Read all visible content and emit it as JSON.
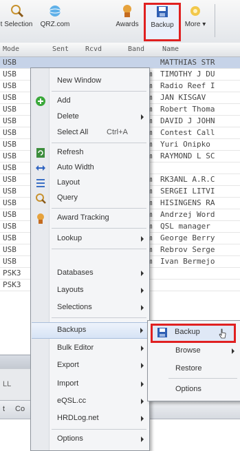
{
  "toolbar": {
    "items": [
      {
        "label": "t Selection"
      },
      {
        "label": "QRZ.com"
      },
      {
        "label": "Awards"
      },
      {
        "label": "Backup"
      },
      {
        "label": "More"
      }
    ]
  },
  "grid": {
    "columns": [
      "Mode",
      "Sent",
      "Rcvd",
      "Band",
      "Name"
    ],
    "rows": [
      {
        "mode": "USB",
        "band": "",
        "name": "MATTHIAS STR"
      },
      {
        "mode": "USB",
        "band": "m",
        "name": "TIMOTHY J DU"
      },
      {
        "mode": "USB",
        "band": "m",
        "name": "Radio Reef I"
      },
      {
        "mode": "USB",
        "band": "m",
        "name": "JAN KISGAV"
      },
      {
        "mode": "USB",
        "band": "m",
        "name": "Robert Thoma"
      },
      {
        "mode": "USB",
        "band": "m",
        "name": "DAVID J JOHN"
      },
      {
        "mode": "USB",
        "band": "m",
        "name": "Contest Call"
      },
      {
        "mode": "USB",
        "band": "m",
        "name": "Yuri Onipko"
      },
      {
        "mode": "USB",
        "band": "m",
        "name": "RAYMOND L SC"
      },
      {
        "mode": "USB",
        "band": "",
        "name": ""
      },
      {
        "mode": "USB",
        "band": "m",
        "name": "RK3ANL A.R.C"
      },
      {
        "mode": "USB",
        "band": "m",
        "name": "SERGEI LITVI"
      },
      {
        "mode": "USB",
        "band": "m",
        "name": "HISINGENS RA"
      },
      {
        "mode": "USB",
        "band": "m",
        "name": "Andrzej Word"
      },
      {
        "mode": "USB",
        "band": "m",
        "name": "QSL manager"
      },
      {
        "mode": "USB",
        "band": "m",
        "name": "George Berry"
      },
      {
        "mode": "USB",
        "band": "m",
        "name": "Rebrov Serge"
      },
      {
        "mode": "USB",
        "band": "m",
        "name": "Ivan Bermejo"
      },
      {
        "mode": "PSK3",
        "band": "",
        "name": ""
      },
      {
        "mode": "PSK3",
        "band": "",
        "name": ""
      }
    ]
  },
  "panels": {
    "left_cut": "LL",
    "tab_left": "t",
    "tab_right": "Co"
  },
  "context_menu": {
    "items": [
      {
        "label": "New Window"
      },
      {
        "label": "Add",
        "icon": "add-icon"
      },
      {
        "label": "Delete"
      },
      {
        "label": "Select All",
        "shortcut": "Ctrl+A"
      },
      {
        "label": "Refresh",
        "icon": "refresh-icon"
      },
      {
        "label": "Auto Width",
        "icon": "auto-width-icon"
      },
      {
        "label": "Layout",
        "icon": "layout-icon"
      },
      {
        "label": "Query",
        "icon": "query-icon"
      },
      {
        "label": "Award Tracking",
        "icon": "award-icon"
      },
      {
        "label": "Lookup"
      },
      {
        "label": "Databases"
      },
      {
        "label": "Layouts"
      },
      {
        "label": "Selections"
      },
      {
        "label": "Backups"
      },
      {
        "label": "Bulk Editor"
      },
      {
        "label": "Export"
      },
      {
        "label": "Import"
      },
      {
        "label": "eQSL.cc"
      },
      {
        "label": "HRDLog.net"
      },
      {
        "label": "Options"
      }
    ]
  },
  "submenu": {
    "items": [
      {
        "label": "Backup",
        "icon": "save-icon"
      },
      {
        "label": "Browse"
      },
      {
        "label": "Restore"
      },
      {
        "label": "Options"
      }
    ]
  },
  "colors": {
    "highlight_border": "#e02020",
    "selection": "#c6d3e8"
  }
}
